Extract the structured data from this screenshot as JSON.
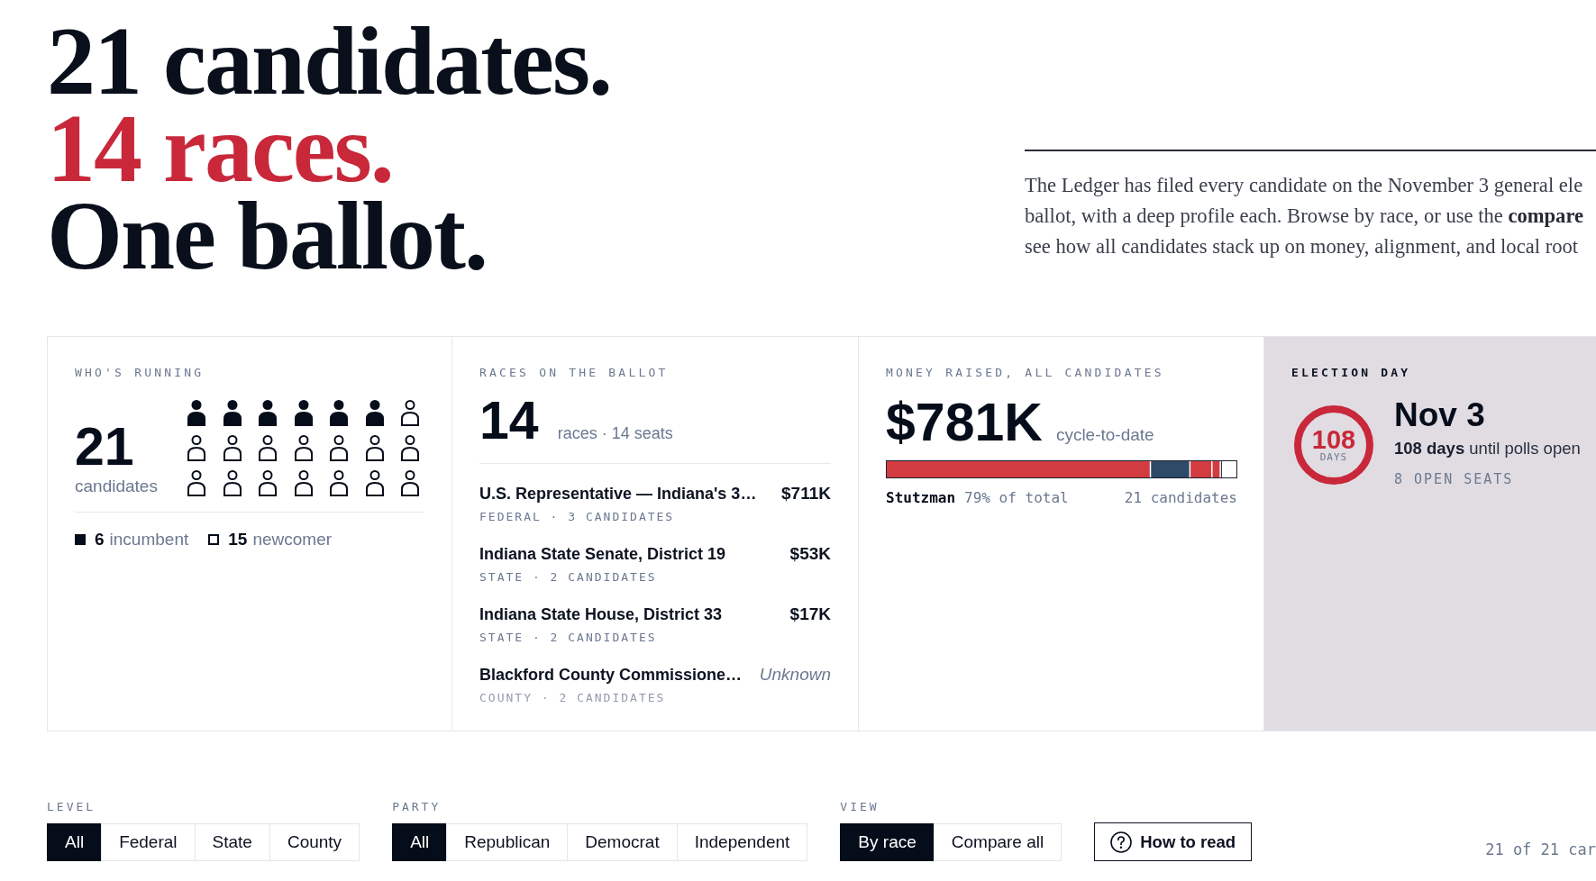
{
  "headline": [
    {
      "text": "21 candidates.",
      "accent": false
    },
    {
      "text": "14 races.",
      "accent": true
    },
    {
      "text": "One ballot.",
      "accent": false
    }
  ],
  "intro": {
    "lines": [
      "The Ledger has filed every candidate on the November 3 general ele",
      "ballot, with a deep profile each. Browse by race, or use the **compare**",
      "see how all candidates stack up on money, alignment, and local root"
    ]
  },
  "cards": [
    {
      "kind": "whos_running",
      "label": "WHO'S RUNNING",
      "count": "21",
      "unit": "candidates",
      "people": [
        {
          "incumbent": true
        },
        {
          "incumbent": true
        },
        {
          "incumbent": true
        },
        {
          "incumbent": true
        },
        {
          "incumbent": true
        },
        {
          "incumbent": true
        },
        {
          "incumbent": false
        },
        {
          "incumbent": false
        },
        {
          "incumbent": false
        },
        {
          "incumbent": false
        },
        {
          "incumbent": false
        },
        {
          "incumbent": false
        },
        {
          "incumbent": false
        },
        {
          "incumbent": false
        },
        {
          "incumbent": false
        },
        {
          "incumbent": false
        },
        {
          "incumbent": false
        },
        {
          "incumbent": false
        },
        {
          "incumbent": false
        },
        {
          "incumbent": false
        },
        {
          "incumbent": false
        }
      ],
      "legend": [
        {
          "kind": "filled",
          "count": "6",
          "label": "incumbent"
        },
        {
          "kind": "outline",
          "count": "15",
          "label": "newcomer"
        }
      ]
    },
    {
      "kind": "races",
      "label": "RACES ON THE BALLOT",
      "count": "14",
      "summary": "races · 14 seats",
      "items": [
        {
          "title": "U.S. Representative — Indiana's 3…",
          "meta": "FEDERAL · 3 CANDIDATES",
          "amount": "$711K",
          "amount_known": true
        },
        {
          "title": "Indiana State Senate, District 19",
          "meta": "STATE · 2 CANDIDATES",
          "amount": "$53K",
          "amount_known": true
        },
        {
          "title": "Indiana State House, District 33",
          "meta": "STATE · 2 CANDIDATES",
          "amount": "$17K",
          "amount_known": true
        },
        {
          "title": "Blackford County Commissione…",
          "meta": "COUNTY · 2 CANDIDATES",
          "amount": "Unknown",
          "amount_known": false
        }
      ]
    },
    {
      "kind": "money",
      "label": "MONEY RAISED, ALL CANDIDATES",
      "total": "$781K",
      "note": "cycle-to-date",
      "leader": "Stutzman",
      "leader_share": "79% of total",
      "candidates": "21 candidates"
    },
    {
      "kind": "election_day",
      "label": "ELECTION DAY",
      "countdown": "108",
      "countdown_unit": "DAYS",
      "date": "Nov 3",
      "countdown_text": "**108 days** until polls open",
      "open_seats": "8 OPEN SEATS"
    }
  ],
  "filters": {
    "groups": [
      {
        "label": "LEVEL",
        "options": [
          {
            "label": "All",
            "selected": true
          },
          {
            "label": "Federal",
            "selected": false
          },
          {
            "label": "State",
            "selected": false
          },
          {
            "label": "County",
            "selected": false
          }
        ]
      },
      {
        "label": "PARTY",
        "options": [
          {
            "label": "All",
            "selected": true
          },
          {
            "label": "Republican",
            "selected": false
          },
          {
            "label": "Democrat",
            "selected": false
          },
          {
            "label": "Independent",
            "selected": false
          }
        ]
      },
      {
        "label": "VIEW",
        "options": [
          {
            "label": "By race",
            "selected": true
          },
          {
            "label": "Compare all",
            "selected": false
          }
        ]
      }
    ],
    "help_button": "How to read",
    "result_count": "21 of 21 car"
  }
}
